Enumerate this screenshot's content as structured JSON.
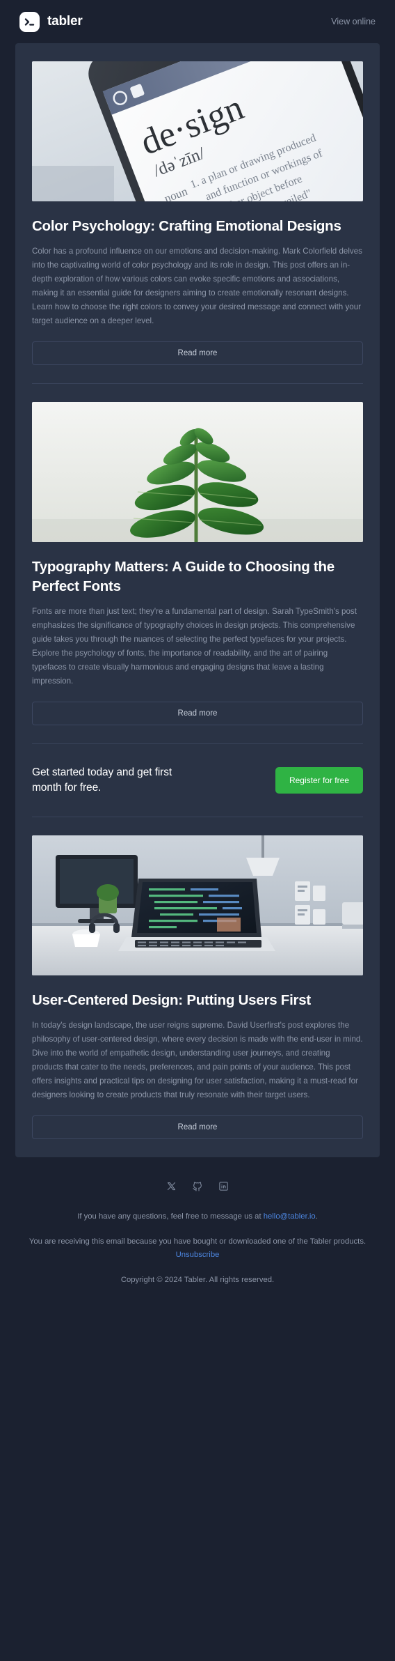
{
  "header": {
    "logo_icon": "terminal-prompt-icon",
    "brand_name": "tabler",
    "view_online_label": "View online"
  },
  "articles": [
    {
      "image_alt": "smartphone-dictionary-design-photo",
      "title": "Color Psychology: Crafting Emotional Designs",
      "body": "Color has a profound influence on our emotions and decision-making. Mark Colorfield delves into the captivating world of color psychology and its role in design. This post offers an in-depth exploration of how various colors can evoke specific emotions and associations, making it an essential guide for designers aiming to create emotionally resonant designs. Learn how to choose the right colors to convey your desired message and connect with your target audience on a deeper level.",
      "read_more_label": "Read more"
    },
    {
      "image_alt": "green-plant-seedling-photo",
      "title": "Typography Matters: A Guide to Choosing the Perfect Fonts",
      "body": "Fonts are more than just text; they're a fundamental part of design. Sarah TypeSmith's post emphasizes the significance of typography choices in design projects. This comprehensive guide takes you through the nuances of selecting the perfect typefaces for your projects. Explore the psychology of fonts, the importance of readability, and the art of pairing typefaces to create visually harmonious and engaging designs that leave a lasting impression.",
      "read_more_label": "Read more"
    },
    {
      "image_alt": "desk-workspace-laptop-code-photo",
      "title": "User-Centered Design: Putting Users First",
      "body": "In today's design landscape, the user reigns supreme. David Userfirst's post explores the philosophy of user-centered design, where every decision is made with the end-user in mind. Dive into the world of empathetic design, understanding user journeys, and creating products that cater to the needs, preferences, and pain points of your audience. This post offers insights and practical tips on designing for user satisfaction, making it a must-read for designers looking to create products that truly resonate with their target users.",
      "read_more_label": "Read more"
    }
  ],
  "cta": {
    "text": "Get started today and get first month for free.",
    "button_label": "Register for free",
    "button_color": "#2fb344"
  },
  "footer": {
    "socials": [
      {
        "icon": "x-twitter-icon",
        "name": "X"
      },
      {
        "icon": "github-icon",
        "name": "GitHub"
      },
      {
        "icon": "linkedin-icon",
        "name": "LinkedIn"
      }
    ],
    "questions_prefix": "If you have any questions, feel free to message us at ",
    "email": "hello@tabler.io",
    "questions_suffix": ".",
    "receiving_text": "You are receiving this email because you have bought or downloaded one of the Tabler products.",
    "unsubscribe_label": "Unsubscribe",
    "copyright": "Copyright © 2024 Tabler. All rights reserved.",
    "link_color": "#4d86e0"
  },
  "theme": {
    "page_bg": "#1b2130",
    "card_bg": "#2a3345",
    "text_primary": "#ffffff",
    "text_muted": "#8d96a8"
  }
}
